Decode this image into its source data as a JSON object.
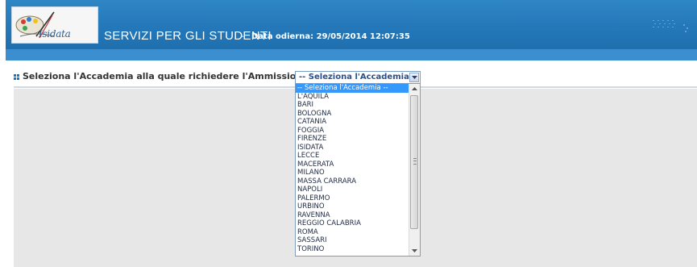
{
  "header": {
    "logo_text": "Isidata",
    "title": "SERVIZI PER GLI STUDENTI",
    "separator": "-",
    "date_line": "Data odierna: 29/05/2014 12:07:35",
    "accent_color": "#2478b9"
  },
  "form": {
    "prompt": "Seleziona l'Accademia alla quale richiedere l'Ammissione:",
    "bullet_icon": "grid-bullet-icon",
    "select_value": "-- Seleziona l'Accademia --",
    "options": [
      "-- Seleziona l'Accademia --",
      "L'AQUILA",
      "BARI",
      "BOLOGNA",
      "CATANIA",
      "FOGGIA",
      "FIRENZE",
      "ISIDATA",
      "LECCE",
      "MACERATA",
      "MILANO",
      "MASSA CARRARA",
      "NAPOLI",
      "PALERMO",
      "URBINO",
      "RAVENNA",
      "REGGIO CALABRIA",
      "ROMA",
      "SASSARI",
      "TORINO"
    ],
    "selected_index": 0
  }
}
